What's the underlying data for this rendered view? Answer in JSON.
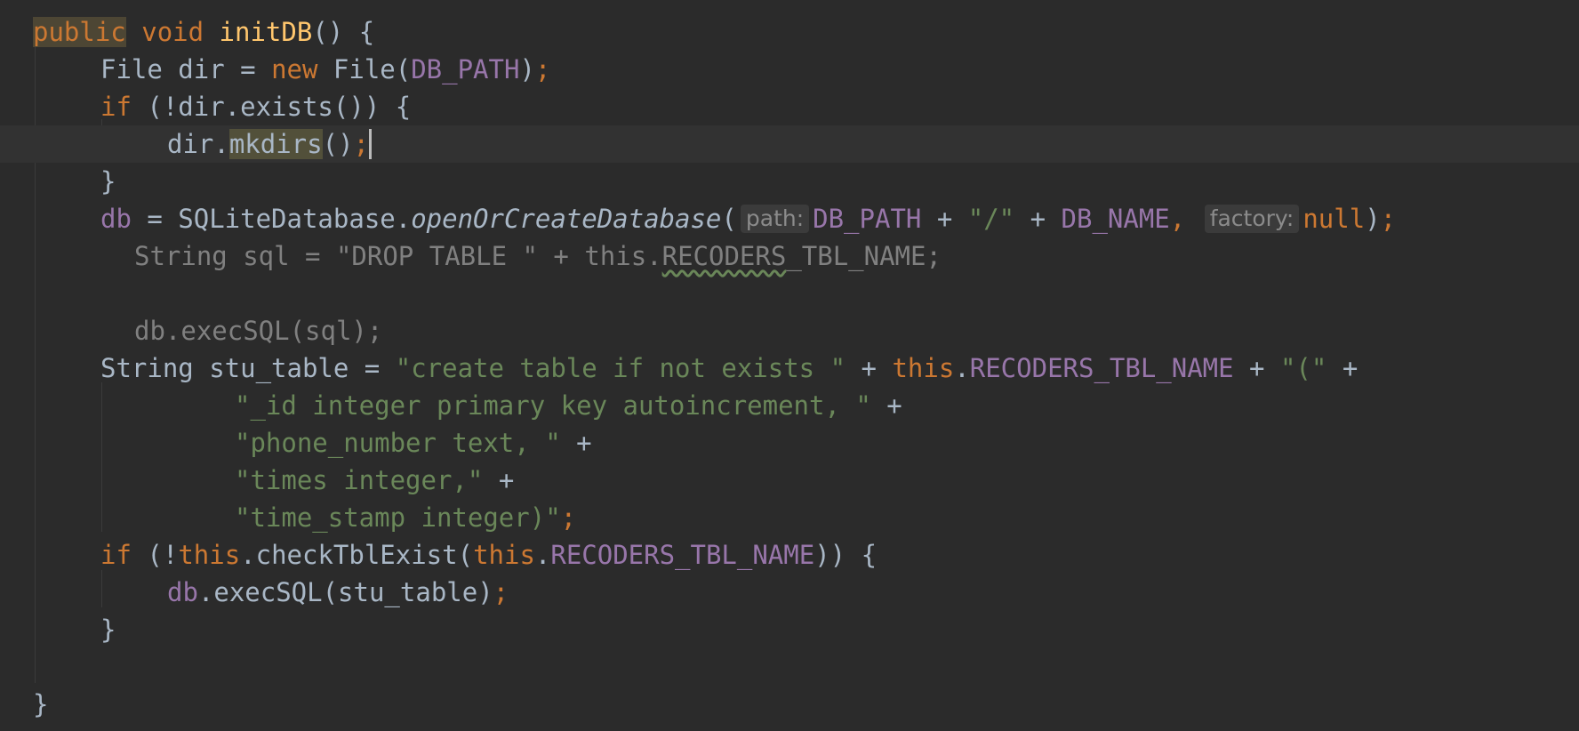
{
  "editor": {
    "lines": {
      "l1": {
        "kw_public": "public",
        "kw_void": "void",
        "method_name": "initDB",
        "rest": "() {"
      },
      "l2": {
        "p1": "File dir = ",
        "kw_new": "new",
        "p2": " File(",
        "fld": "DB_PATH",
        "p3": ")",
        "semi": ";"
      },
      "l3": {
        "kw_if": "if",
        "p1": " (!dir.exists()) {"
      },
      "l4": {
        "p1": "dir.",
        "mkdirs": "mkdirs",
        "p2": "()",
        "semi": ";"
      },
      "l5": {
        "p1": "}"
      },
      "l6": {
        "fld_db": "db",
        "p1": " = SQLiteDatabase.",
        "method": "openOrCreateDatabase",
        "p2": "(",
        "hint_path": "path:",
        "fld_path": "DB_PATH",
        "p3": " + ",
        "str_slash": "\"/\"",
        "p4": " + ",
        "fld_name": "DB_NAME",
        "comma": ",",
        "hint_factory": "factory:",
        "kw_null": "null",
        "p5": ")",
        "semi": ";"
      },
      "l7": {
        "p1": "String sql = \"DROP TABLE \" + this.",
        "squiggle": "RECODERS",
        "p2": "_TBL_NAME;"
      },
      "l9": {
        "p1": "db.execSQL(sql);"
      },
      "l10": {
        "p1": "String stu_table = ",
        "str1": "\"create table if not exists \"",
        "p2": " + ",
        "kw_this": "this",
        "p3": ".",
        "fld": "RECODERS_TBL_NAME",
        "p4": " + ",
        "str2": "\"(\"",
        "p5": " +"
      },
      "l11": {
        "str": "\"_id integer primary key autoincrement, \"",
        "p1": " +"
      },
      "l12": {
        "str": "\"phone_number text, \"",
        "p1": " +"
      },
      "l13": {
        "str": "\"times integer,\"",
        "p1": " +"
      },
      "l14": {
        "str": "\"time_stamp integer)\"",
        "semi": ";"
      },
      "l15": {
        "kw_if": "if",
        "p1": " (!",
        "kw_this1": "this",
        "p2": ".checkTblExist(",
        "kw_this2": "this",
        "p3": ".",
        "fld": "RECODERS_TBL_NAME",
        "p4": ")) {"
      },
      "l16": {
        "fld_db": "db",
        "p1": ".execSQL(stu_table)",
        "semi": ";"
      },
      "l17": {
        "p1": "}"
      },
      "l19": {
        "p1": "}"
      }
    }
  }
}
